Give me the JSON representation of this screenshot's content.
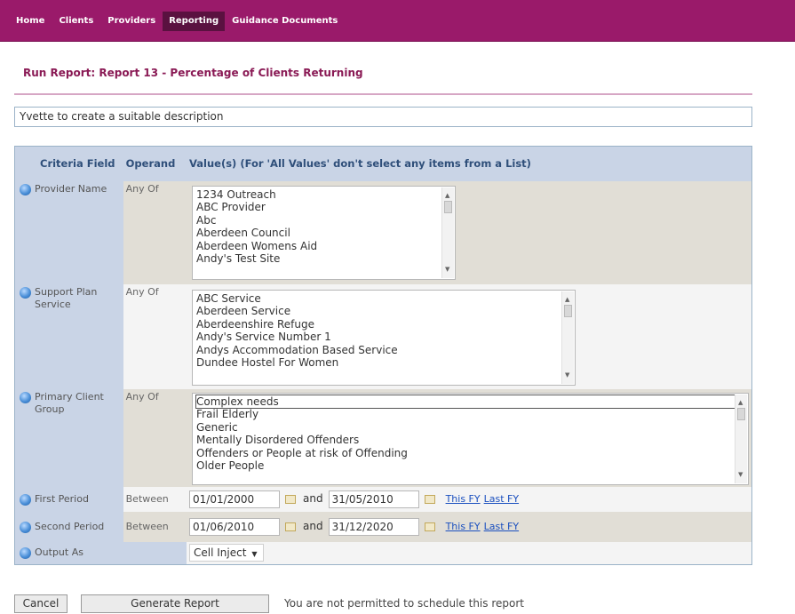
{
  "nav": [
    "Home",
    "Clients",
    "Providers",
    "Reporting",
    "Guidance Documents"
  ],
  "nav_active": "Reporting",
  "title": "Run Report: Report 13 - Percentage of Clients Returning",
  "description": "Yvette to create a suitable description",
  "table": {
    "headers": {
      "field": "Criteria Field",
      "operand": "Operand",
      "values": "Value(s) (For 'All Values' don't select any items from a List)"
    },
    "provider_name": {
      "label": "Provider Name",
      "operand": "Any Of",
      "options": [
        "1234 Outreach",
        "ABC Provider",
        "Abc",
        "Aberdeen Council",
        "Aberdeen Womens Aid",
        "Andy's Test Site"
      ]
    },
    "support_plan_service": {
      "label": "Support Plan Service",
      "operand": "Any Of",
      "options": [
        "ABC Service",
        "Aberdeen Service",
        "Aberdeenshire Refuge",
        "Andy's Service Number 1",
        "Andys Accommodation Based Service",
        "Dundee Hostel For Women"
      ]
    },
    "primary_client_group": {
      "label": "Primary Client Group",
      "operand": "Any Of",
      "options": [
        "Complex needs",
        "Frail Elderly",
        "Generic",
        "Mentally Disordered Offenders",
        "Offenders or People at risk of Offending",
        "Older People"
      ]
    },
    "first_period": {
      "label": "First Period",
      "operand": "Between",
      "from": "01/01/2000",
      "and": "and",
      "to": "31/05/2010",
      "link1": "This FY",
      "link2": "Last FY"
    },
    "second_period": {
      "label": "Second Period",
      "operand": "Between",
      "from": "01/06/2010",
      "and": "and",
      "to": "31/12/2020",
      "link1": "This FY",
      "link2": "Last FY"
    },
    "output_as": {
      "label": "Output As",
      "value": "Cell Inject"
    }
  },
  "buttons": {
    "cancel": "Cancel",
    "generate": "Generate Report"
  },
  "schedule_note": "You are not permitted to schedule this report"
}
